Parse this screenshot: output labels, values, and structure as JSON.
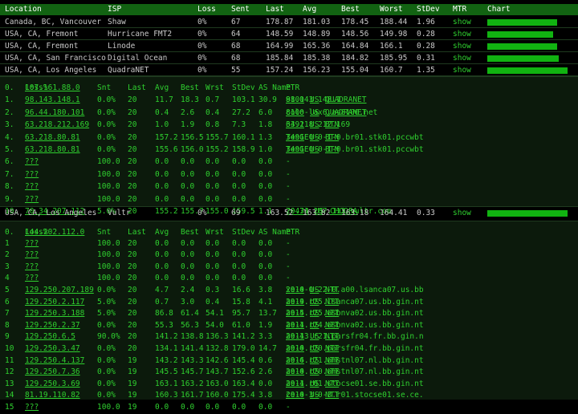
{
  "top_table": {
    "headers": [
      "Location",
      "ISP",
      "Loss",
      "Sent",
      "Last",
      "Avg",
      "Best",
      "Worst",
      "StDev",
      "MTR",
      "Chart"
    ],
    "rows": [
      {
        "location": "Canada, BC, Vancouver",
        "isp": "Shaw",
        "loss": "0%",
        "sent": "67",
        "last": "178.87",
        "avg": "181.03",
        "best": "178.45",
        "worst": "188.44",
        "stdev": "1.96",
        "mtr": "show",
        "chart": 0.85
      },
      {
        "location": "USA, CA, Fremont",
        "isp": "Hurricane FMT2",
        "loss": "0%",
        "sent": "64",
        "last": "148.59",
        "avg": "148.89",
        "best": "148.56",
        "worst": "149.98",
        "stdev": "0.28",
        "mtr": "show",
        "chart": 0.8
      },
      {
        "location": "USA, CA, Fremont",
        "isp": "Linode",
        "loss": "0%",
        "sent": "68",
        "last": "164.99",
        "avg": "165.36",
        "best": "164.84",
        "worst": "166.1",
        "stdev": "0.28",
        "mtr": "show",
        "chart": 0.85
      },
      {
        "location": "USA, CA, San Francisco",
        "isp": "Digital Ocean",
        "loss": "0%",
        "sent": "68",
        "last": "185.84",
        "avg": "185.38",
        "best": "184.82",
        "worst": "185.95",
        "stdev": "0.31",
        "mtr": "show",
        "chart": 0.87
      },
      {
        "location": "USA, CA, Los Angeles",
        "isp": "QuadraNET",
        "loss": "0%",
        "sent": "55",
        "last": "157.24",
        "avg": "156.23",
        "best": "155.04",
        "worst": "160.7",
        "stdev": "1.35",
        "mtr": "show",
        "chart": 0.98
      }
    ]
  },
  "mtr1": {
    "headers": [
      "",
      "Loss%",
      "Snt",
      "Last",
      "Avg",
      "Best",
      "Wrst",
      "StDev",
      "AS Name",
      "PTR"
    ],
    "first_hop": "0.",
    "first_ip": "107.161.88.0",
    "hops": [
      {
        "n": "1.",
        "host": "98.143.148.1",
        "loss": "0.0%",
        "snt": "20",
        "last": "11.7",
        "avg": "18.3",
        "best": "0.7",
        "wrst": "103.1",
        "stdev": "30.9",
        "asn": "8100",
        "cc": "US",
        "asname": "QUADRANET",
        "ptr": "98.143.148.1"
      },
      {
        "n": "2.",
        "host": "96.44.180.101",
        "loss": "0.0%",
        "snt": "20",
        "last": "0.4",
        "avg": "2.6",
        "best": "0.4",
        "wrst": "27.2",
        "stdev": "6.0",
        "asn": "8100",
        "cc": "US",
        "asname": "QUADRANET",
        "ptr": "colo-lax6.as8100.net"
      },
      {
        "n": "3.",
        "host": "63.218.212.169",
        "loss": "0.0%",
        "snt": "20",
        "last": "1.0",
        "avg": "1.9",
        "best": "0.8",
        "wrst": "7.3",
        "stdev": "1.8",
        "asn": "3491",
        "cc": "US",
        "asname": "BTN",
        "ptr": "63.218.212.169"
      },
      {
        "n": "4.",
        "host": "63.218.80.81",
        "loss": "0.0%",
        "snt": "20",
        "last": "157.2",
        "avg": "156.5",
        "best": "155.7",
        "wrst": "160.1",
        "stdev": "1.3",
        "asn": "3491",
        "cc": "US",
        "asname": "BTN",
        "ptr": "TenGE0-0-1-0.br01.stk01.pccwbt"
      },
      {
        "n": "5.",
        "host": "63.218.80.81",
        "loss": "0.0%",
        "snt": "20",
        "last": "155.6",
        "avg": "156.0",
        "best": "155.2",
        "wrst": "158.9",
        "stdev": "1.0",
        "asn": "3491",
        "cc": "US",
        "asname": "BTN",
        "ptr": "TenGE0-0-1-0.br01.stk01.pccwbt"
      },
      {
        "n": "6.",
        "host": "???",
        "loss": "100.0",
        "snt": "20",
        "last": "0.0",
        "avg": "0.0",
        "best": "0.0",
        "wrst": "0.0",
        "stdev": "0.0",
        "asn": "",
        "cc": "",
        "asname": "-",
        "ptr": ""
      },
      {
        "n": "7.",
        "host": "???",
        "loss": "100.0",
        "snt": "20",
        "last": "0.0",
        "avg": "0.0",
        "best": "0.0",
        "wrst": "0.0",
        "stdev": "0.0",
        "asn": "",
        "cc": "",
        "asname": "-",
        "ptr": ""
      },
      {
        "n": "8.",
        "host": "???",
        "loss": "100.0",
        "snt": "20",
        "last": "0.0",
        "avg": "0.0",
        "best": "0.0",
        "wrst": "0.0",
        "stdev": "0.0",
        "asn": "",
        "cc": "",
        "asname": "-",
        "ptr": ""
      },
      {
        "n": "9.",
        "host": "???",
        "loss": "100.0",
        "snt": "20",
        "last": "0.0",
        "avg": "0.0",
        "best": "0.0",
        "wrst": "0.0",
        "stdev": "0.0",
        "asn": "",
        "cc": "",
        "asname": "-",
        "ptr": ""
      },
      {
        "n": "10.",
        "host": "70.34.207.112",
        "loss": "5.0%",
        "snt": "20",
        "last": "155.2",
        "avg": "155.7",
        "best": "155.0",
        "wrst": "159.5",
        "stdev": "1.1",
        "asn": "20473",
        "cc": "US",
        "asname": "CHOOPA",
        "ptr": "70.34.207.112.vultr.com"
      }
    ]
  },
  "middle_row": {
    "location": "USA, CA, Los Angeles",
    "isp": "Vultr",
    "loss": "0%",
    "sent": "69",
    "last": "163.52",
    "avg": "163.82",
    "best": "163.18",
    "worst": "164.41",
    "stdev": "0.33",
    "mtr": "show",
    "chart": 0.98
  },
  "mtr2": {
    "headers": [
      "",
      "Loss%",
      "Snt",
      "Last",
      "Avg",
      "Best",
      "Wrst",
      "StDev",
      "AS Name",
      "PTR"
    ],
    "first_hop": "0.",
    "first_ip": "144.202.112.0",
    "hops": [
      {
        "n": "1",
        "host": "???",
        "loss": "100.0",
        "snt": "20",
        "last": "0.0",
        "avg": "0.0",
        "best": "0.0",
        "wrst": "0.0",
        "stdev": "0.0",
        "asn": "",
        "cc": "",
        "asname": "-",
        "ptr": ""
      },
      {
        "n": "2",
        "host": "???",
        "loss": "100.0",
        "snt": "20",
        "last": "0.0",
        "avg": "0.0",
        "best": "0.0",
        "wrst": "0.0",
        "stdev": "0.0",
        "asn": "",
        "cc": "",
        "asname": "-",
        "ptr": ""
      },
      {
        "n": "3",
        "host": "???",
        "loss": "100.0",
        "snt": "20",
        "last": "0.0",
        "avg": "0.0",
        "best": "0.0",
        "wrst": "0.0",
        "stdev": "0.0",
        "asn": "",
        "cc": "",
        "asname": "-",
        "ptr": ""
      },
      {
        "n": "4",
        "host": "???",
        "loss": "100.0",
        "snt": "20",
        "last": "0.0",
        "avg": "0.0",
        "best": "0.0",
        "wrst": "0.0",
        "stdev": "0.0",
        "asn": "",
        "cc": "",
        "asname": "-",
        "ptr": ""
      },
      {
        "n": "5",
        "host": "129.250.207.189",
        "loss": "0.0%",
        "snt": "20",
        "last": "4.7",
        "avg": "2.4",
        "best": "0.3",
        "wrst": "16.6",
        "stdev": "3.8",
        "asn": "2914",
        "cc": "US",
        "asname": "NTT",
        "ptr": "xe-0-0-22-0.a00.lsanca07.us.bb"
      },
      {
        "n": "6",
        "host": "129.250.2.117",
        "loss": "5.0%",
        "snt": "20",
        "last": "0.7",
        "avg": "3.0",
        "best": "0.4",
        "wrst": "15.8",
        "stdev": "4.1",
        "asn": "2914",
        "cc": "US",
        "asname": "NTT",
        "ptr": "ae-9.r25.lsanca07.us.bb.gin.nt"
      },
      {
        "n": "7",
        "host": "129.250.3.188",
        "loss": "5.0%",
        "snt": "20",
        "last": "86.8",
        "avg": "61.4",
        "best": "54.1",
        "wrst": "95.7",
        "stdev": "13.7",
        "asn": "2914",
        "cc": "US",
        "asname": "NTT",
        "ptr": "ae-5.r25.asbnva02.us.bb.gin.nt"
      },
      {
        "n": "8",
        "host": "129.250.2.37",
        "loss": "0.0%",
        "snt": "20",
        "last": "55.3",
        "avg": "56.3",
        "best": "54.0",
        "wrst": "61.0",
        "stdev": "1.9",
        "asn": "2914",
        "cc": "US",
        "asname": "NTT",
        "ptr": "ae-1.r24.asbnva02.us.bb.gin.nt"
      },
      {
        "n": "9",
        "host": "129.250.6.5",
        "loss": "90.0%",
        "snt": "20",
        "last": "141.2",
        "avg": "138.8",
        "best": "136.3",
        "wrst": "141.2",
        "stdev": "3.3",
        "asn": "2914",
        "cc": "US",
        "asname": "NTT",
        "ptr": "ae-13.r21.parsfr04.fr.bb.gin.n"
      },
      {
        "n": "10",
        "host": "129.250.3.47",
        "loss": "0.0%",
        "snt": "20",
        "last": "134.1",
        "avg": "141.4",
        "best": "132.8",
        "wrst": "179.0",
        "stdev": "14.7",
        "asn": "2914",
        "cc": "US",
        "asname": "NTT",
        "ptr": "ae-0.r20.parsfr04.fr.bb.gin.nt"
      },
      {
        "n": "11",
        "host": "129.250.4.137",
        "loss": "0.0%",
        "snt": "19",
        "last": "143.2",
        "avg": "143.3",
        "best": "142.6",
        "wrst": "145.4",
        "stdev": "0.6",
        "asn": "2914",
        "cc": "US",
        "asname": "NTT",
        "ptr": "ae-6.r21.amstnl07.nl.bb.gin.nt"
      },
      {
        "n": "12",
        "host": "129.250.7.36",
        "loss": "0.0%",
        "snt": "19",
        "last": "145.5",
        "avg": "145.7",
        "best": "143.7",
        "wrst": "152.6",
        "stdev": "2.6",
        "asn": "2914",
        "cc": "US",
        "asname": "NTT",
        "ptr": "ae-0.r20.amstnl07.nl.bb.gin.nt"
      },
      {
        "n": "13",
        "host": "129.250.3.69",
        "loss": "0.0%",
        "snt": "19",
        "last": "163.1",
        "avg": "163.2",
        "best": "163.0",
        "wrst": "163.4",
        "stdev": "0.0",
        "asn": "2914",
        "cc": "US",
        "asname": "NTT",
        "ptr": "ae-1.r01.stocse01.se.bb.gin.nt"
      },
      {
        "n": "14",
        "host": "81.19.110.82",
        "loss": "0.0%",
        "snt": "19",
        "last": "160.3",
        "avg": "161.7",
        "best": "160.0",
        "wrst": "175.4",
        "stdev": "3.8",
        "asn": "2914",
        "cc": "US",
        "asname": "NTT",
        "ptr": "ce-0-3-0-3.r01.stocse01.se.ce."
      },
      {
        "n": "15",
        "host": "???",
        "loss": "100.0",
        "snt": "19",
        "last": "0.0",
        "avg": "0.0",
        "best": "0.0",
        "wrst": "0.0",
        "stdev": "0.0",
        "asn": "",
        "cc": "",
        "asname": "-",
        "ptr": ""
      }
    ]
  }
}
